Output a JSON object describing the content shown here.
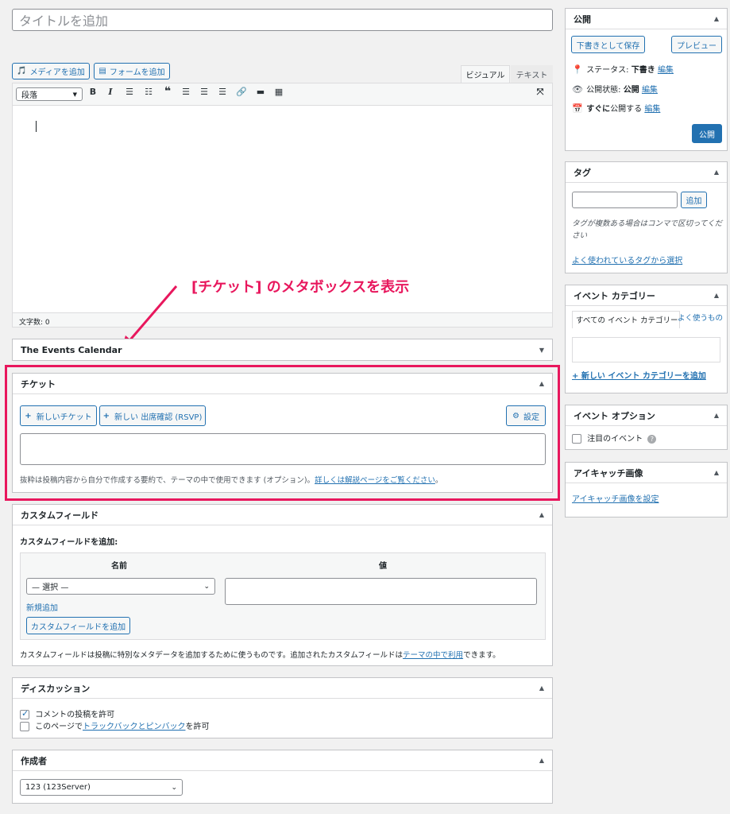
{
  "title_placeholder": "タイトルを追加",
  "media": {
    "add_media": "メディアを追加",
    "add_form": "フォームを追加"
  },
  "editor_tabs": {
    "visual": "ビジュアル",
    "text": "テキスト"
  },
  "format_select": "段落",
  "word_count": "文字数: 0",
  "annotation": "[チケット] のメタボックスを表示",
  "events_calendar": {
    "title": "The Events Calendar"
  },
  "tickets": {
    "title": "チケット",
    "new_ticket": "新しいチケット",
    "new_rsvp": "新しい 出席確認 (RSVP)",
    "settings": "設定",
    "description": "抜粋は投稿内容から自分で作成する要約で、テーマの中で使用できます (オプション)。",
    "description_link": "詳しくは解説ページをご覧ください",
    "description_end": "。"
  },
  "custom_fields": {
    "title": "カスタムフィールド",
    "add_label": "カスタムフィールドを追加:",
    "col_name": "名前",
    "col_value": "値",
    "select_value": "— 選択 —",
    "new_link": "新規追加",
    "add_button": "カスタムフィールドを追加",
    "note_pre": "カスタムフィールドは投稿に特別なメタデータを追加するために使うものです。追加されたカスタムフィールドは",
    "note_link": "テーマの中で利用",
    "note_post": "できます。"
  },
  "discussion": {
    "title": "ディスカッション",
    "allow_comments": "コメントの投稿を許可",
    "allow_comments_checked": true,
    "pings_pre": "このページで",
    "pings_link": "トラックバックとピンバック",
    "pings_post": "を許可",
    "pings_checked": false
  },
  "author": {
    "title": "作成者",
    "value": "123 (123Server)"
  },
  "publish": {
    "title": "公開",
    "save_draft": "下書きとして保存",
    "preview": "プレビュー",
    "status_label": "ステータス:",
    "status_value": "下書き",
    "edit": "編集",
    "visibility_label": "公開状態:",
    "visibility_value": "公開",
    "schedule_value": "すぐに",
    "schedule_label": "公開する",
    "publish_button": "公開"
  },
  "tags": {
    "title": "タグ",
    "add": "追加",
    "help": "タグが複数ある場合はコンマで区切ってください",
    "popular_link": "よく使われているタグから選択"
  },
  "event_categories": {
    "title": "イベント カテゴリー",
    "tab_all": "すべての イベント カテゴリー",
    "tab_popular": "よく使うもの",
    "add_new": "+ 新しい イベント カテゴリーを追加"
  },
  "event_options": {
    "title": "イベント オプション",
    "featured": "注目のイベント"
  },
  "featured_image": {
    "title": "アイキャッチ画像",
    "set_link": "アイキャッチ画像を設定"
  },
  "colors": {
    "accent": "#2271b1",
    "highlight": "#e8175d"
  }
}
